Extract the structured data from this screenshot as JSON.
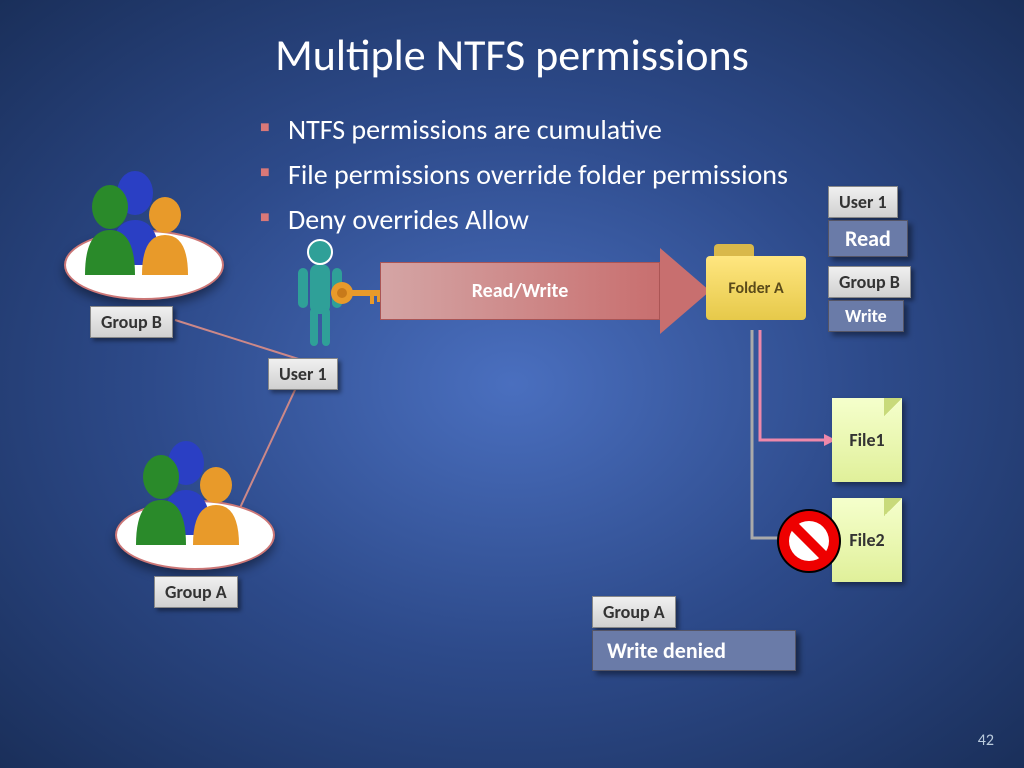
{
  "title": "Multiple NTFS permissions",
  "bullets": {
    "b1": "NTFS permissions are cumulative",
    "b2": "File permissions override folder permissions",
    "b3": "Deny overrides Allow"
  },
  "labels": {
    "group_b_top": "Group  B",
    "group_a_bottom": "Group A",
    "user1_center": "User 1",
    "arrow_text": "Read/Write",
    "folder_a": "Folder A",
    "user1_right": "User 1",
    "read_perm": "Read",
    "group_b_right": "Group  B",
    "write_perm": "Write",
    "file1": "File1",
    "file2": "File2",
    "group_a_right": "Group A",
    "write_denied": "Write denied"
  },
  "page_number": "42"
}
